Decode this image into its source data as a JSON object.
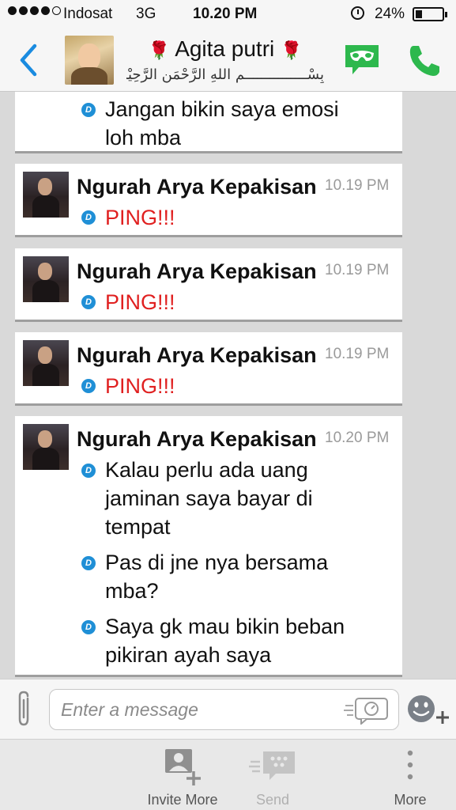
{
  "status_bar": {
    "carrier": "Indosat",
    "network": "3G",
    "time": "10.20 PM",
    "battery_percent_label": "24%",
    "battery_level": 0.24,
    "signal_bars_filled": 4,
    "signal_bars_total": 5
  },
  "header": {
    "contact_name": "Agita putri",
    "name_decoration": "🌹",
    "contact_status": "بِسْـــــــــــــــمِ اللهِ الرَّحْمَنِ الرَّحِيْمِ",
    "icons": {
      "back": "chevron-left-icon",
      "private_chat": "mask-chat-icon",
      "call": "phone-icon"
    },
    "accent_color": "#1a8be0",
    "call_color": "#2db84d"
  },
  "messages": [
    {
      "sender": "",
      "time": "",
      "lines": [
        "Jangan bikin saya emosi loh mba"
      ],
      "partial": true
    },
    {
      "sender": "Ngurah Arya Kepakisan",
      "time": "10.19 PM",
      "lines": [
        "PING!!!"
      ],
      "ping": true
    },
    {
      "sender": "Ngurah Arya Kepakisan",
      "time": "10.19 PM",
      "lines": [
        "PING!!!"
      ],
      "ping": true
    },
    {
      "sender": "Ngurah Arya Kepakisan",
      "time": "10.19 PM",
      "lines": [
        "PING!!!"
      ],
      "ping": true
    },
    {
      "sender": "Ngurah Arya Kepakisan",
      "time": "10.20 PM",
      "lines": [
        "Kalau perlu ada uang jaminan saya bayar di tempat",
        "Pas di jne nya bersama mba?",
        "Saya gk mau bikin beban pikiran ayah saya"
      ]
    }
  ],
  "delivered_mark": "D",
  "composer": {
    "placeholder": "Enter a message",
    "icons": {
      "attach": "paperclip-icon",
      "voice": "voice-note-icon",
      "emoji": "emoji-add-icon"
    }
  },
  "toolbar": {
    "invite_label": "Invite More",
    "send_label": "Send",
    "more_label": "More"
  }
}
